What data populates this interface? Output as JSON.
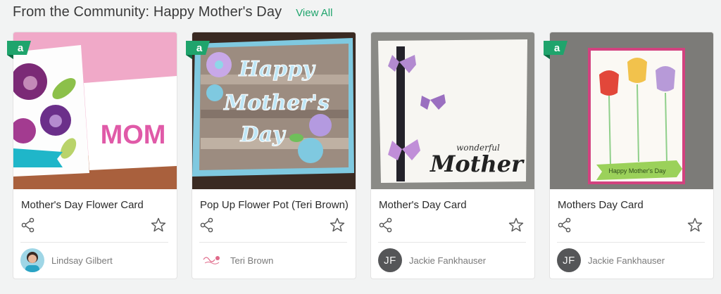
{
  "section": {
    "title": "From the Community: Happy Mother's Day",
    "view_all": "View All"
  },
  "colors": {
    "accent": "#1fa46c",
    "badge": "#1fa46c",
    "avatar_initials_bg": "#555658"
  },
  "cards": [
    {
      "name": "Mother's Day Flower Card",
      "author": "Lindsay Gilbert",
      "avatar_type": "photo",
      "badge": "a",
      "image_text": "MOM"
    },
    {
      "name": "Pop Up Flower Pot (Teri Brown)",
      "author": "Teri Brown",
      "avatar_type": "logo",
      "badge": "a",
      "image_text": "Happy Mother's Day"
    },
    {
      "name": "Mother's Day Card",
      "author": "Jackie Fankhauser",
      "avatar_type": "initials",
      "avatar_initials": "JF",
      "image_text_small": "wonderful",
      "image_text": "Mother"
    },
    {
      "name": "Mothers Day Card",
      "author": "Jackie Fankhauser",
      "avatar_type": "initials",
      "avatar_initials": "JF",
      "badge": "a",
      "image_text": "Happy Mother's Day"
    }
  ]
}
